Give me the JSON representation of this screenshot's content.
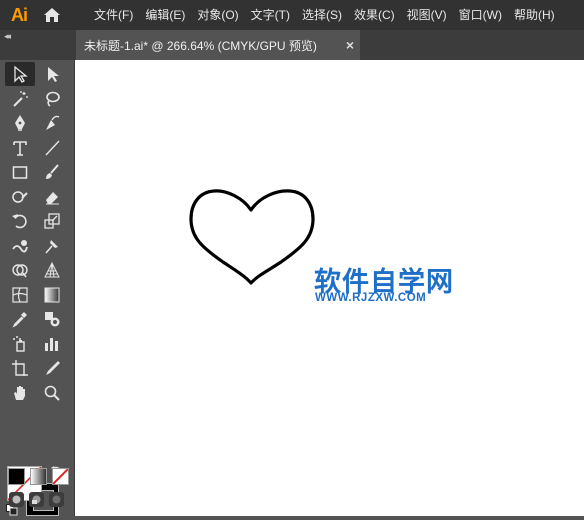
{
  "app": {
    "logo_text": "Ai",
    "accent": "#ff9a00"
  },
  "menu": {
    "items": [
      {
        "label": "文件(F)"
      },
      {
        "label": "编辑(E)"
      },
      {
        "label": "对象(O)"
      },
      {
        "label": "文字(T)"
      },
      {
        "label": "选择(S)"
      },
      {
        "label": "效果(C)"
      },
      {
        "label": "视图(V)"
      },
      {
        "label": "窗口(W)"
      },
      {
        "label": "帮助(H)"
      }
    ]
  },
  "panel": {
    "collapse_glyph": "◂◂"
  },
  "document_tab": {
    "title": "未标题-1.ai* @ 266.64% (CMYK/GPU 预览)",
    "close_glyph": "×"
  },
  "toolbar": {
    "tools": [
      [
        "selection-tool",
        "direct-selection-tool"
      ],
      [
        "magic-wand-tool",
        "lasso-tool"
      ],
      [
        "pen-tool",
        "curvature-tool"
      ],
      [
        "type-tool",
        "line-segment-tool"
      ],
      [
        "rectangle-tool",
        "paintbrush-tool"
      ],
      [
        "shaper-tool",
        "eraser-tool"
      ],
      [
        "rotate-tool",
        "scale-tool"
      ],
      [
        "warp-tool",
        "puppet-warp-tool"
      ],
      [
        "shape-builder-tool",
        "perspective-grid-tool"
      ],
      [
        "mesh-tool",
        "gradient-tool"
      ],
      [
        "eyedropper-tool",
        "blend-tool"
      ],
      [
        "symbol-sprayer-tool",
        "column-graph-tool"
      ],
      [
        "artboard-tool",
        "slice-tool"
      ],
      [
        "hand-tool",
        "zoom-tool"
      ]
    ],
    "fill": "none",
    "stroke": "#000000"
  },
  "canvas": {
    "watermark_cn": "软件自学网",
    "watermark_url": "WWW.RJZXW.COM",
    "watermark_color": "#1e6fc7",
    "shape": "heart"
  }
}
